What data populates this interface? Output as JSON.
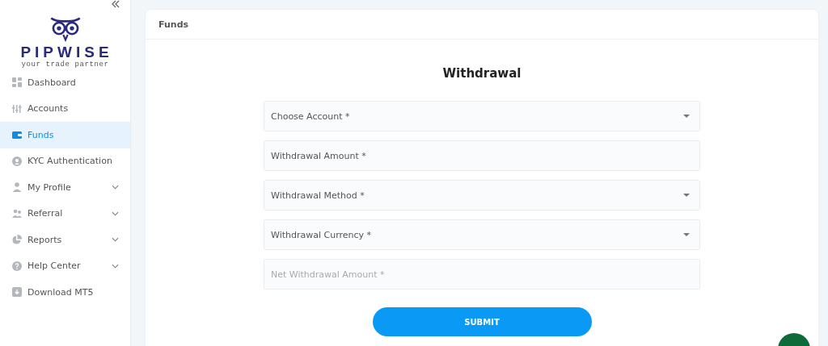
{
  "logo": {
    "name": "PIPWISE",
    "tagline": "your trade partner"
  },
  "sidebar": {
    "items": [
      {
        "label": "Dashboard",
        "selected": false,
        "expandable": false
      },
      {
        "label": "Accounts",
        "selected": false,
        "expandable": false
      },
      {
        "label": "Funds",
        "selected": true,
        "expandable": false
      },
      {
        "label": "KYC Authentication",
        "selected": false,
        "expandable": false
      },
      {
        "label": "My Profile",
        "selected": false,
        "expandable": true
      },
      {
        "label": "Referral",
        "selected": false,
        "expandable": true
      },
      {
        "label": "Reports",
        "selected": false,
        "expandable": true
      },
      {
        "label": "Help Center",
        "selected": false,
        "expandable": true
      },
      {
        "label": "Download MT5",
        "selected": false,
        "expandable": false
      }
    ]
  },
  "card": {
    "title": "Funds",
    "heading": "Withdrawal",
    "fields": [
      {
        "kind": "select",
        "placeholder": "Choose Account *",
        "disabled": false
      },
      {
        "kind": "input",
        "placeholder": "Withdrawal Amount *",
        "disabled": false
      },
      {
        "kind": "select",
        "placeholder": "Withdrawal Method *",
        "disabled": false
      },
      {
        "kind": "select",
        "placeholder": "Withdrawal Currency *",
        "disabled": false
      },
      {
        "kind": "input",
        "placeholder": "Net Withdrawal Amount *",
        "disabled": true
      }
    ],
    "submit": "SUBMIT"
  }
}
